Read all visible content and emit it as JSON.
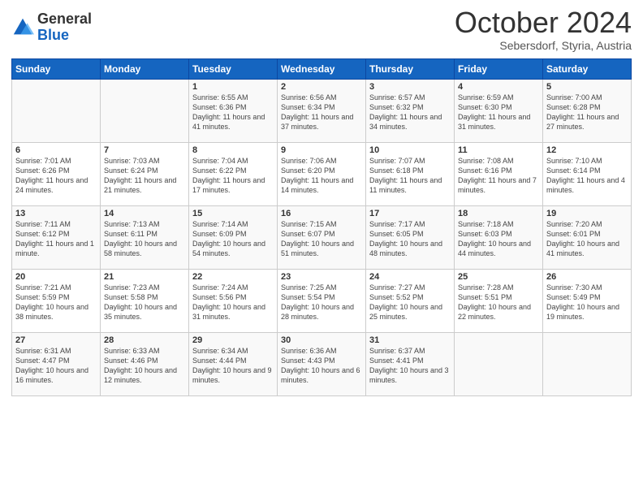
{
  "header": {
    "logo_general": "General",
    "logo_blue": "Blue",
    "month": "October 2024",
    "location": "Sebersdorf, Styria, Austria"
  },
  "days_of_week": [
    "Sunday",
    "Monday",
    "Tuesday",
    "Wednesday",
    "Thursday",
    "Friday",
    "Saturday"
  ],
  "weeks": [
    [
      {
        "day": "",
        "content": ""
      },
      {
        "day": "",
        "content": ""
      },
      {
        "day": "1",
        "content": "Sunrise: 6:55 AM\nSunset: 6:36 PM\nDaylight: 11 hours and 41 minutes."
      },
      {
        "day": "2",
        "content": "Sunrise: 6:56 AM\nSunset: 6:34 PM\nDaylight: 11 hours and 37 minutes."
      },
      {
        "day": "3",
        "content": "Sunrise: 6:57 AM\nSunset: 6:32 PM\nDaylight: 11 hours and 34 minutes."
      },
      {
        "day": "4",
        "content": "Sunrise: 6:59 AM\nSunset: 6:30 PM\nDaylight: 11 hours and 31 minutes."
      },
      {
        "day": "5",
        "content": "Sunrise: 7:00 AM\nSunset: 6:28 PM\nDaylight: 11 hours and 27 minutes."
      }
    ],
    [
      {
        "day": "6",
        "content": "Sunrise: 7:01 AM\nSunset: 6:26 PM\nDaylight: 11 hours and 24 minutes."
      },
      {
        "day": "7",
        "content": "Sunrise: 7:03 AM\nSunset: 6:24 PM\nDaylight: 11 hours and 21 minutes."
      },
      {
        "day": "8",
        "content": "Sunrise: 7:04 AM\nSunset: 6:22 PM\nDaylight: 11 hours and 17 minutes."
      },
      {
        "day": "9",
        "content": "Sunrise: 7:06 AM\nSunset: 6:20 PM\nDaylight: 11 hours and 14 minutes."
      },
      {
        "day": "10",
        "content": "Sunrise: 7:07 AM\nSunset: 6:18 PM\nDaylight: 11 hours and 11 minutes."
      },
      {
        "day": "11",
        "content": "Sunrise: 7:08 AM\nSunset: 6:16 PM\nDaylight: 11 hours and 7 minutes."
      },
      {
        "day": "12",
        "content": "Sunrise: 7:10 AM\nSunset: 6:14 PM\nDaylight: 11 hours and 4 minutes."
      }
    ],
    [
      {
        "day": "13",
        "content": "Sunrise: 7:11 AM\nSunset: 6:12 PM\nDaylight: 11 hours and 1 minute."
      },
      {
        "day": "14",
        "content": "Sunrise: 7:13 AM\nSunset: 6:11 PM\nDaylight: 10 hours and 58 minutes."
      },
      {
        "day": "15",
        "content": "Sunrise: 7:14 AM\nSunset: 6:09 PM\nDaylight: 10 hours and 54 minutes."
      },
      {
        "day": "16",
        "content": "Sunrise: 7:15 AM\nSunset: 6:07 PM\nDaylight: 10 hours and 51 minutes."
      },
      {
        "day": "17",
        "content": "Sunrise: 7:17 AM\nSunset: 6:05 PM\nDaylight: 10 hours and 48 minutes."
      },
      {
        "day": "18",
        "content": "Sunrise: 7:18 AM\nSunset: 6:03 PM\nDaylight: 10 hours and 44 minutes."
      },
      {
        "day": "19",
        "content": "Sunrise: 7:20 AM\nSunset: 6:01 PM\nDaylight: 10 hours and 41 minutes."
      }
    ],
    [
      {
        "day": "20",
        "content": "Sunrise: 7:21 AM\nSunset: 5:59 PM\nDaylight: 10 hours and 38 minutes."
      },
      {
        "day": "21",
        "content": "Sunrise: 7:23 AM\nSunset: 5:58 PM\nDaylight: 10 hours and 35 minutes."
      },
      {
        "day": "22",
        "content": "Sunrise: 7:24 AM\nSunset: 5:56 PM\nDaylight: 10 hours and 31 minutes."
      },
      {
        "day": "23",
        "content": "Sunrise: 7:25 AM\nSunset: 5:54 PM\nDaylight: 10 hours and 28 minutes."
      },
      {
        "day": "24",
        "content": "Sunrise: 7:27 AM\nSunset: 5:52 PM\nDaylight: 10 hours and 25 minutes."
      },
      {
        "day": "25",
        "content": "Sunrise: 7:28 AM\nSunset: 5:51 PM\nDaylight: 10 hours and 22 minutes."
      },
      {
        "day": "26",
        "content": "Sunrise: 7:30 AM\nSunset: 5:49 PM\nDaylight: 10 hours and 19 minutes."
      }
    ],
    [
      {
        "day": "27",
        "content": "Sunrise: 6:31 AM\nSunset: 4:47 PM\nDaylight: 10 hours and 16 minutes."
      },
      {
        "day": "28",
        "content": "Sunrise: 6:33 AM\nSunset: 4:46 PM\nDaylight: 10 hours and 12 minutes."
      },
      {
        "day": "29",
        "content": "Sunrise: 6:34 AM\nSunset: 4:44 PM\nDaylight: 10 hours and 9 minutes."
      },
      {
        "day": "30",
        "content": "Sunrise: 6:36 AM\nSunset: 4:43 PM\nDaylight: 10 hours and 6 minutes."
      },
      {
        "day": "31",
        "content": "Sunrise: 6:37 AM\nSunset: 4:41 PM\nDaylight: 10 hours and 3 minutes."
      },
      {
        "day": "",
        "content": ""
      },
      {
        "day": "",
        "content": ""
      }
    ]
  ]
}
